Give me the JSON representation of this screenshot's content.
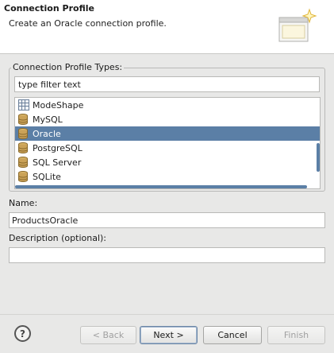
{
  "banner": {
    "title": "Connection Profile",
    "description": "Create an Oracle connection profile."
  },
  "types": {
    "label": "Connection Profile Types:",
    "filter_value": "type filter text",
    "items": [
      {
        "label": "ModeShape",
        "icon": "grid-icon"
      },
      {
        "label": "MySQL",
        "icon": "database-icon"
      },
      {
        "label": "Oracle",
        "icon": "database-icon",
        "selected": true
      },
      {
        "label": "PostgreSQL",
        "icon": "database-icon"
      },
      {
        "label": "SQL Server",
        "icon": "database-icon"
      },
      {
        "label": "SQLite",
        "icon": "database-icon"
      }
    ]
  },
  "name": {
    "label": "Name:",
    "value": "ProductsOracle"
  },
  "description": {
    "label": "Description (optional):",
    "value": ""
  },
  "buttons": {
    "help": "?",
    "back": "< Back",
    "next": "Next >",
    "cancel": "Cancel",
    "finish": "Finish"
  }
}
